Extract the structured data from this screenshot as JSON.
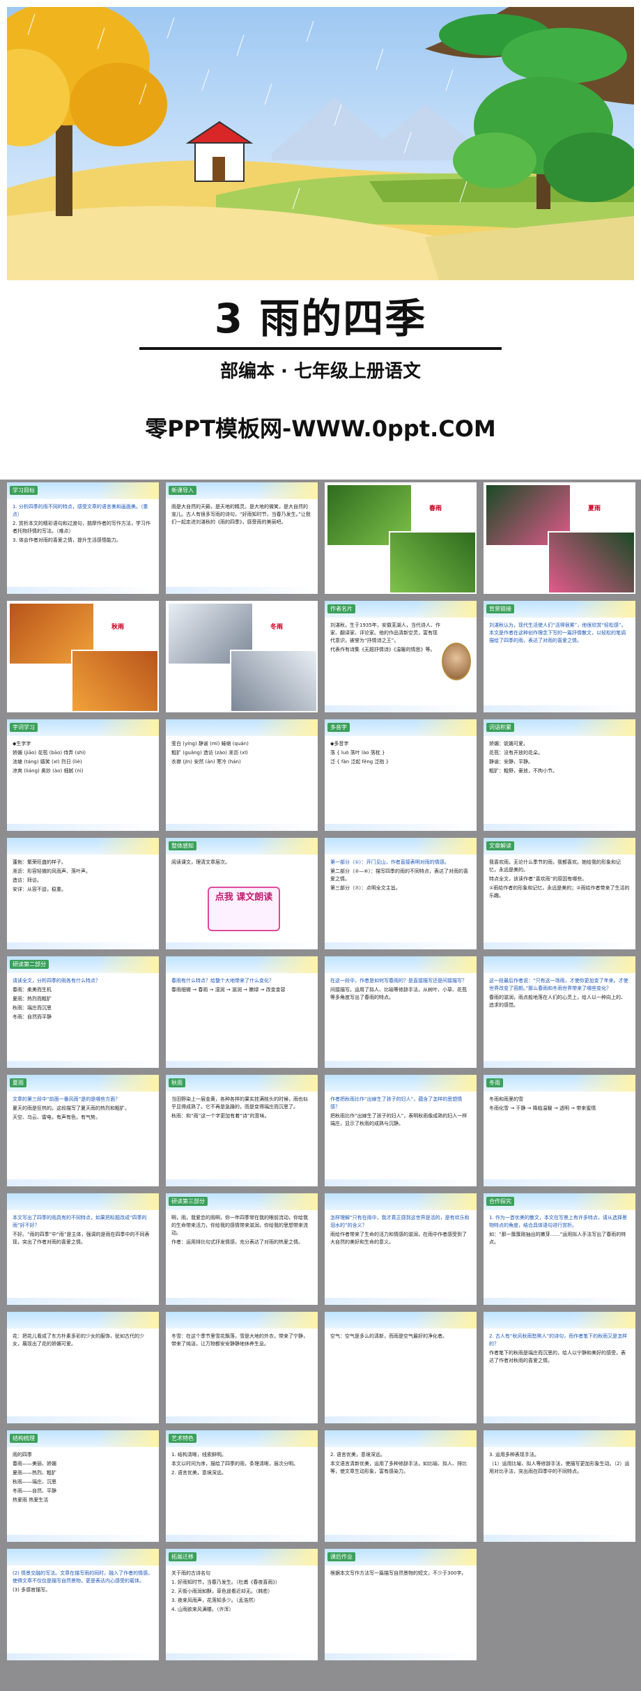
{
  "cover": {
    "title": "3  雨的四季",
    "subtitle": "部编本  · 七年级上册语文",
    "site": "零PPT模板网-WWW.0ppt.COM"
  },
  "slides": [
    {
      "tag": "学习目标",
      "lines": [
        "1. 分析四季的雨不同的特点，感受文章的语言美和画面美。（重点）",
        "2. 赏析本文的精彩语句和过渡句，揣摩作者的写作方法，学习作者托物抒情的写法。（难点）",
        "3. 体会作者对雨的喜爱之情，提升生活感悟能力。"
      ]
    },
    {
      "tag": "新课导入",
      "lines": [
        "雨是大自然的天籁，是天地的精灵。是大地的微笑，是大自然的宠儿。古人有很多写雨的诗句，“好雨知时节，当春乃发生。”让我们一起走进刘湛秋的《雨的四季》，感受雨的美丽吧。"
      ]
    },
    {
      "tag": "",
      "lines": [],
      "captions": [
        "春雨"
      ]
    },
    {
      "tag": "",
      "lines": [],
      "captions": [
        "夏雨"
      ]
    },
    {
      "tag": "",
      "lines": [],
      "captions": [
        "秋雨"
      ]
    },
    {
      "tag": "",
      "lines": [],
      "captions": [
        "冬雨"
      ]
    },
    {
      "tag": "作者名片",
      "lines": [
        "刘湛秋，生于1935年，安徽芜湖人，当代诗人、作家、翻译家、评论家。他的作品清新空灵，富有现代意识，被誉为“抒情诗之王”。",
        "代表作有诗集《无题抒情诗》《温暖的情思》等。"
      ]
    },
    {
      "tag": "背景链接",
      "lines": [
        "刘湛秋认为，现代生活使人们“活得很累”，他很欣赏“轻松感”。本文是作者在这种创作理念下写的一篇抒情散文，以轻松的笔调描绘了四季的雨，表达了对雨的喜爱之情。"
      ]
    },
    {
      "tag": "字词学习",
      "lines": [
        "◆生字字",
        "娇媚 (jiāo) 花苞 (bāo) 侍弄 (shì)",
        "池塘 (táng) 嬉笑 (xī) 烈日 (liè)",
        "凉爽 (liáng) 奥妙 (ào) 细腻 (nì)"
      ]
    },
    {
      "tag": "",
      "lines": [
        "莹白 (yíng) 静谧 (mì) 蜷缩 (quán)",
        "粗犷 (guǎng) 造访 (zào) 淅沥 (xī)",
        "衣襟 (jīn) 安然 (ān) 寒冷 (hán)"
      ]
    },
    {
      "tag": "多音字",
      "lines": [
        "◆多音字",
        "落 { luò 落叶  lào 落枕 }",
        "泛 { fàn 泛起  fěng 泛指 }"
      ]
    },
    {
      "tag": "词语积累",
      "lines": [
        "娇媚：妩媚可爱。",
        "花苞：没有开放的花朵。",
        "静谧：安静，平静。",
        "粗犷：粗野，豪放，不拘小节。"
      ]
    },
    {
      "tag": "",
      "lines": [
        "蓬勃：繁荣旺盛的样子。",
        "淅沥：形容轻微的风雨声、落叶声。",
        "造访：拜访。",
        "安详：从容不迫，稳重。"
      ]
    },
    {
      "tag": "整体感知",
      "lines": [
        "阅读课文，理清文章层次。"
      ],
      "stamp": "点我 课文朗读"
    },
    {
      "tag": "",
      "lines": [
        "第一部分（①）：开门见山，作者直接表明对雨的情感。",
        "第二部分（②—⑥）：描写四季的雨的不同特点，表达了对雨的喜爱之情。",
        "第三部分（⑦）：点明全文主旨。"
      ]
    },
    {
      "tag": "文章解读",
      "lines": [
        "我喜欢雨，无论什么季节的雨，我都喜欢。她给我的形象和记忆，永远是美的。",
        "特点全文，该读作者“喜欢雨”的原因有哪些。",
        "①雨给作者的形象和记忆，永远是美的；②雨给作者带来了生活的乐趣。"
      ]
    },
    {
      "tag": "研读第二部分",
      "lines": [
        "请读全文，分析四季的雨各有什么特点？",
        "春雨：柔美而生机",
        "夏雨：热烈而粗犷",
        "秋雨：端庄而沉思",
        "冬雨：自然而平静"
      ]
    },
    {
      "tag": "",
      "lines": [
        "春雨有什么特点？给整个大地带来了什么变化？",
        "春雨细微 → 春雨 → 湿润 → 滋润 → 嫩绿 → 改变变容"
      ]
    },
    {
      "tag": "",
      "lines": [
        "在这一段中，作者是如何写春雨的？是直接描写还是间接描写？",
        "间接描写。运用了拟人、比喻等修辞手法，从树叶、小草、花苞等多角度写出了春雨的特点。"
      ]
    },
    {
      "tag": "",
      "lines": [
        "这一段最后作者说：“只有这一场雨，才使你更加变了年来。才使世界改变了容颜。”那么春雨和冬雨世界带来了哪些变化？",
        "春雨的滋润，雨点般地落在人们的心灵上，给人以一种向上的、追求的感觉。"
      ]
    },
    {
      "tag": "夏雨",
      "lines": [
        "文章的第三段中“前面一番风雨”是的是哪些方面？",
        "夏天的雨是狂热的。这段描写了夏天雨的热烈和粗犷。",
        "天空、乌云、雷电，有声有色，有气势。"
      ]
    },
    {
      "tag": "秋雨",
      "lines": [
        "当田野染上一层金黄，各种各样的果实挂满枝头的时候，雨也似乎显得成熟了。它不再是急躁的，而是变得端庄而沉思了。",
        "秋雨：和“雨”这一个字更加有着“诗”的意味。"
      ]
    },
    {
      "tag": "",
      "lines": [
        "作者把秋雨比作“出嫁生了孩子的妇人”，蕴含了怎样的思想情感？",
        "把秋雨比作“出嫁生了孩子的妇人”，表明秋雨像成熟的妇人一样端庄，显示了秋雨的成熟与沉静。"
      ]
    },
    {
      "tag": "冬雨",
      "lines": [
        "冬雨和雨里的雪",
        "冬雨化雪 → 干静 → 降临温暖 → 透明 → 带来蜜情"
      ]
    },
    {
      "tag": "",
      "lines": [
        "本文写出了四季的雨具有的不同特点，如果把标题改成“四季的雨”好不好？",
        "不好。“雨的四季”中“雨”是主体，强调的是雨在四季中的不同表现，突出了作者对雨的喜爱之情。"
      ]
    },
    {
      "tag": "研读第三部分",
      "lines": [
        "啊，雨，我爱恋的雨啊，你一年四季常在我的眼前流动，你给我的生命带来活力，你给我的感情带来滋润，你给我的思想带来流动。",
        "作者：运用排比句式抒发情感，充分表达了对雨的热爱之情。"
      ]
    },
    {
      "tag": "",
      "lines": [
        "怎样理解“只有在雨中，我才真正感到这世界是活的，是有欢乐和泪水的”的含义？",
        "雨给作者带来了生命的活力和情感的滋润，在雨中作者感受到了大自然的美好和生命的意义。"
      ]
    },
    {
      "tag": "合作探究",
      "lines": [
        "1. 作为一首优美的散文，本文在写景上有许多特点，请从选择景物特点的角度，结合具体语句进行赏析。",
        "如：“那一簇簇刚抽出的嫩芽……”运用拟人手法写出了春雨的特点。"
      ]
    },
    {
      "tag": "",
      "lines": [
        "花：把花儿看成了东方朴素多彩的少女的服饰，犹如古代的少女，展现出了花的娇媚可爱。"
      ]
    },
    {
      "tag": "",
      "lines": [
        "冬雪：在这个季节里雪花飘落，雪是大地的外衣，带来了宁静，带来了纯洁，让万物都安安静静地休养生息。"
      ]
    },
    {
      "tag": "",
      "lines": [
        "空气：空气是多么的清新，而雨是空气最好的净化者。"
      ]
    },
    {
      "tag": "",
      "lines": [
        "2. 古人有“秋风秋雨愁煞人”的诗句，而作者笔下的秋雨又是怎样的？",
        "作者笔下的秋雨是端庄而沉思的，给人以宁静和美好的感受，表达了作者对秋雨的喜爱之情。"
      ]
    },
    {
      "tag": "结构梳理",
      "lines": [
        "雨的四季",
        "春雨——美丽、娇媚",
        "夏雨——热烈、粗犷",
        "秋雨——端庄、沉思",
        "冬雨——自然、平静",
        "热爱雨 热爱生活"
      ]
    },
    {
      "tag": "艺术特色",
      "lines": [
        "1. 结构清晰，线索鲜明。",
        "本文以时间为序，描绘了四季的雨，条理清晰，层次分明。",
        "2. 语言优美，意境深远。"
      ]
    },
    {
      "tag": "",
      "lines": [
        "2. 语言优美，意境深远。",
        "本文语言清新优美，运用了多种修辞手法，如比喻、拟人、排比等，使文章生动形象，富有感染力。"
      ]
    },
    {
      "tag": "",
      "lines": [
        "3. 运用多种表现手法。",
        "（1）运用比喻、拟人等修辞手法，使描写更加形象生动。（2）运用对比手法，突出雨在四季中的不同特点。"
      ]
    },
    {
      "tag": "",
      "lines": [
        "(2) 情景交融的写法。文章在描写雨的同时，融入了作者的情感，使得文章不仅仅是描写自然景物，更是表达内心感受的载体。",
        "(3) 多感官描写。"
      ]
    },
    {
      "tag": "拓展迁移",
      "lines": [
        "关于雨的古诗名句",
        "1. 好雨知时节，当春乃发生。（杜甫《春夜喜雨》）",
        "2. 天街小雨润如酥，草色遥看近却无。（韩愈）",
        "3. 夜来风雨声，花落知多少。（孟浩然）",
        "4. 山雨欲来风满楼。（许浑）"
      ]
    },
    {
      "tag": "课后作业",
      "lines": [
        "根据本文写作方法写一篇描写自然景物的短文，不少于300字。"
      ]
    }
  ]
}
